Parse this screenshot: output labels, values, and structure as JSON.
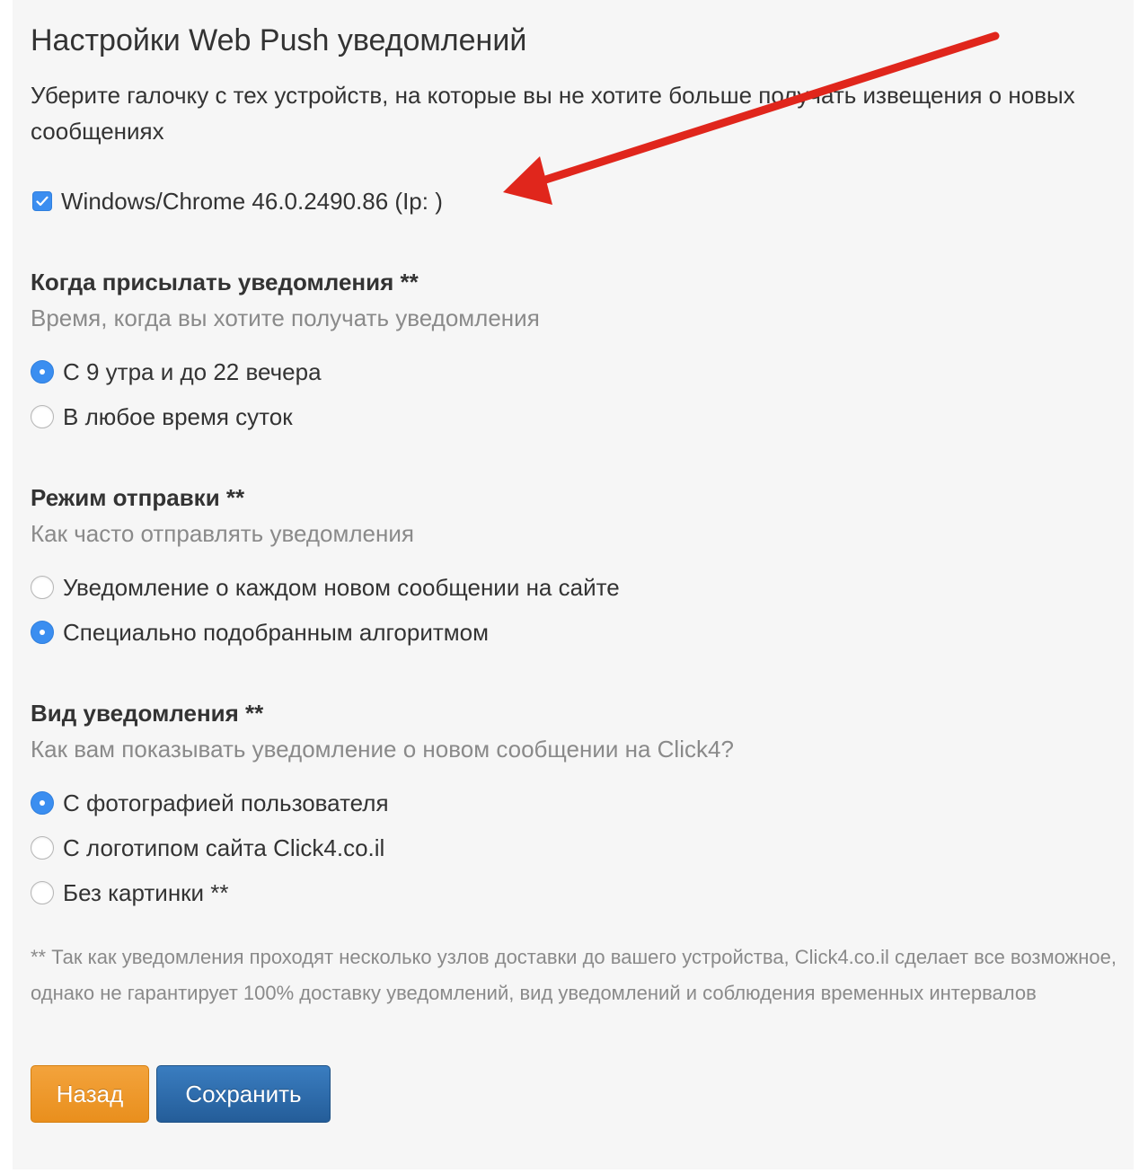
{
  "page": {
    "title": "Настройки Web Push уведомлений",
    "intro": "Уберите галочку с тех устройств, на которые вы не хотите больше получать извещения о новых сообщениях"
  },
  "devices": [
    {
      "label": "Windows/Chrome 46.0.2490.86 (Ip: )",
      "checked": true
    }
  ],
  "when": {
    "heading": "Когда присылать уведомления **",
    "subtitle": "Время, когда вы хотите получать уведомления",
    "options": [
      {
        "label": "С 9 утра и до 22 вечера",
        "selected": true
      },
      {
        "label": "В любое время суток",
        "selected": false
      }
    ]
  },
  "mode": {
    "heading": "Режим отправки **",
    "subtitle": "Как часто отправлять уведомления",
    "options": [
      {
        "label": "Уведомление о каждом новом сообщении на сайте",
        "selected": false
      },
      {
        "label": "Специально подобранным алгоритмом",
        "selected": true
      }
    ]
  },
  "view": {
    "heading": "Вид уведомления **",
    "subtitle": "Как вам показывать уведомление о новом сообщении на Click4?",
    "options": [
      {
        "label": "С фотографией пользователя",
        "selected": true
      },
      {
        "label": "С логотипом сайта Click4.co.il",
        "selected": false
      },
      {
        "label": "Без картинки **",
        "selected": false
      }
    ]
  },
  "footnote": "** Так как уведомления проходят несколько узлов доставки до вашего устройства, Click4.co.il сделает все возможное, однако не гарантирует 100% доставку уведомлений, вид уведомлений и соблюдения временных интервалов",
  "buttons": {
    "back": "Назад",
    "save": "Сохранить"
  },
  "colors": {
    "accent": "#3b8ef0",
    "back_button": "#ee9a2c",
    "save_button": "#2f6dad",
    "annotation_arrow": "#e0261c"
  }
}
